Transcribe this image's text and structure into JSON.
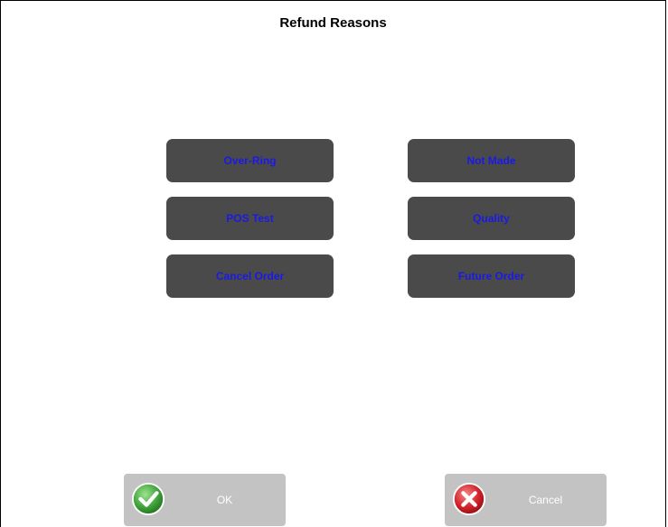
{
  "dialog": {
    "title": "Refund Reasons"
  },
  "reasons": [
    {
      "label": "Over-Ring"
    },
    {
      "label": "Not Made"
    },
    {
      "label": "POS Test"
    },
    {
      "label": "Quality"
    },
    {
      "label": "Cancel Order"
    },
    {
      "label": "Future Order"
    }
  ],
  "actions": {
    "ok_label": "OK",
    "cancel_label": "Cancel"
  },
  "colors": {
    "reason_button_bg": "#4a4a4a",
    "reason_button_text": "#1a1ae6",
    "action_button_bg": "#c3c3c3",
    "ok_icon": "#3fa33a",
    "cancel_icon": "#d4202a"
  },
  "icons": {
    "ok": "check-circle-icon",
    "cancel": "x-circle-icon"
  }
}
